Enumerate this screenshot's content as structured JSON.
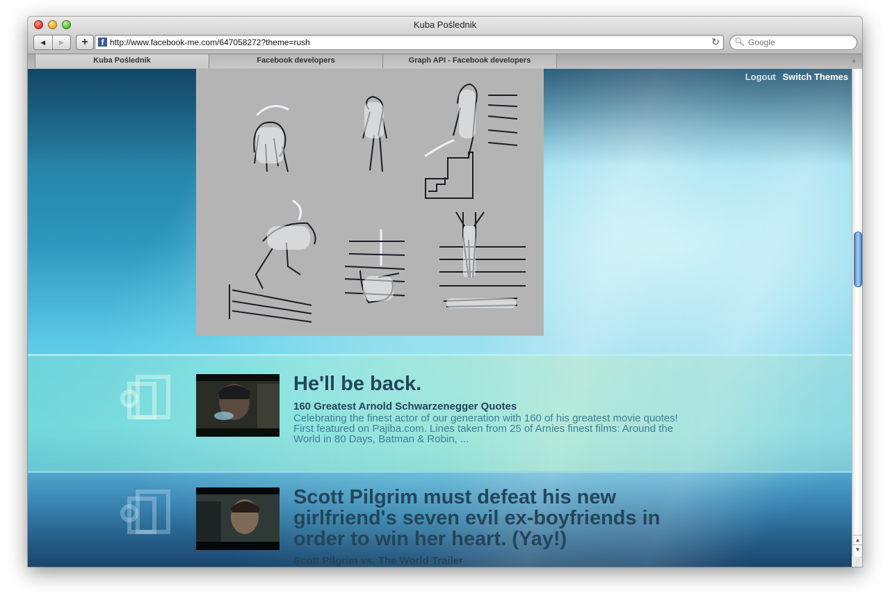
{
  "window": {
    "title": "Kuba Poślednik"
  },
  "toolbar": {
    "back_glyph": "◀",
    "forward_glyph": "▶",
    "add_glyph": "+",
    "url": "http://www.facebook-me.com/647058272?theme=rush",
    "reload_glyph": "↻",
    "search_placeholder": "Google",
    "search_glyph": "🔍︎"
  },
  "tabs": [
    {
      "label": "Kuba Poślednik",
      "active": true
    },
    {
      "label": "Facebook developers",
      "active": false
    },
    {
      "label": "Graph API - Facebook developers",
      "active": false
    }
  ],
  "new_tab_glyph": "+",
  "header": {
    "logout": "Logout",
    "switch_themes": "Switch Themes"
  },
  "posts": [
    {
      "title": "He'll be back.",
      "subtitle": "160 Greatest Arnold Schwarzenegger Quotes",
      "description": "Celebrating the finest actor of our generation with 160 of his greatest movie quotes! First featured on Pajiba.com. Lines taken from 25 of Arnies finest films: Around the World in 80 Days, Batman & Robin, ..."
    },
    {
      "title": "Scott Pilgrim must defeat his new girlfriend's seven evil ex-boyfriends in order to win her heart. (Yay!)",
      "subtitle": "Scott Pilgrim vs. The World Trailer"
    }
  ],
  "scrollbar": {
    "up_glyph": "▲",
    "down_glyph": "▼",
    "position": 0.38
  },
  "colors": {
    "title_text": "#24455a",
    "desc_text": "#3c7f92",
    "accent": "#5cc9e6"
  },
  "icons": [
    "video-post-icon",
    "search-icon",
    "reload-icon",
    "facebook-favicon"
  ]
}
